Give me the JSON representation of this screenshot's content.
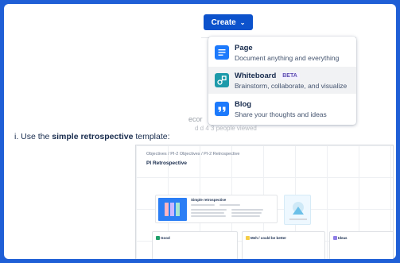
{
  "create_button": {
    "label": "Create",
    "chevron": "⌄"
  },
  "menu": {
    "items": [
      {
        "title": "Page",
        "subtitle": "Document anything and everything",
        "icon": "page-icon"
      },
      {
        "title": "Whiteboard",
        "badge": "BETA",
        "subtitle": "Brainstorm, collaborate, and visualize",
        "icon": "whiteboard-icon"
      },
      {
        "title": "Blog",
        "subtitle": "Share your thoughts and ideas",
        "icon": "blog-icon"
      }
    ]
  },
  "background_text": {
    "fragment1": "ecor",
    "fragment2": "d     d  4 3 people viewed"
  },
  "instruction": {
    "prefix": "i. Use the ",
    "bold": "simple retrospective",
    "suffix": " template:"
  },
  "preview": {
    "breadcrumb": "Objectives  /  PI-2 Objectives  /  PI-2 Retrospective",
    "title": "PI Retrospective",
    "template_title": "Simple retrospective",
    "columns": [
      "Good",
      "Meh / could be better",
      "Ideas"
    ]
  },
  "colors": {
    "frame": "#1f5fd6",
    "accent": "#0c52cc",
    "page_icon": "#1d7afc",
    "whiteboard_icon": "#1d9aaa",
    "blog_icon": "#1d7afc"
  }
}
